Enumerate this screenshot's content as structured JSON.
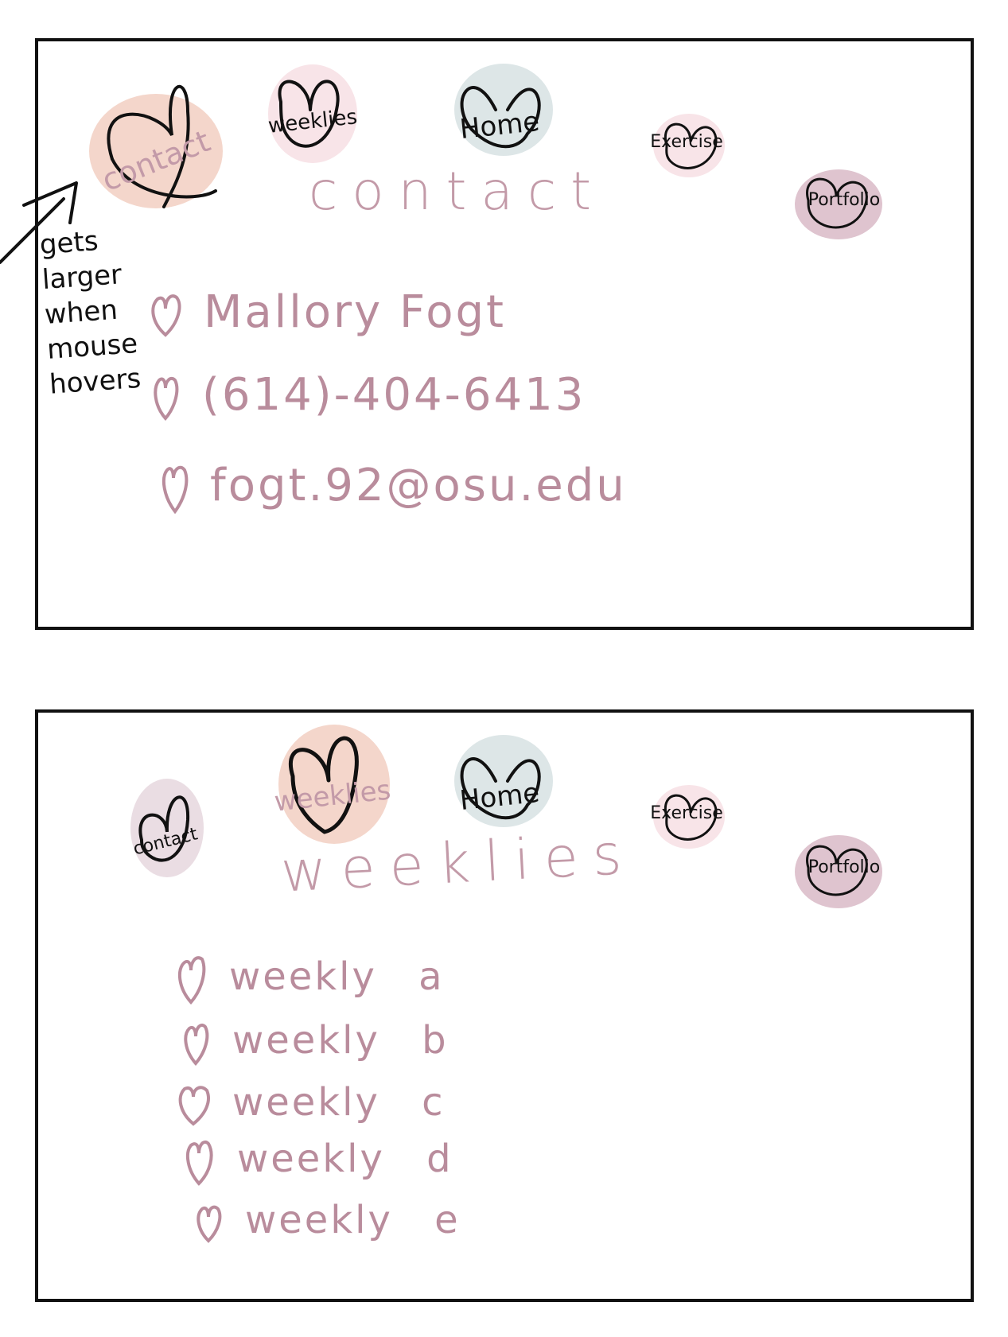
{
  "nav": {
    "contact": "contact",
    "weeklies": "weeklies",
    "home": "Home",
    "exercise": "Exercise",
    "portfolio": "Portfolio"
  },
  "colors": {
    "peach": "#f4d6cb",
    "pink": "#f8e4e8",
    "blue_gray": "#dde6e7",
    "mauve": "#dfc4cf",
    "ink": "#111111",
    "text_mauve": "#b98c9c"
  },
  "contact_page": {
    "title": "contact",
    "annotation": "gets\nlarger\nwhen\nmouse\nhovers",
    "lines": [
      "Mallory Fogt",
      "(614)-404-6413",
      "fogt.92@osu.edu"
    ]
  },
  "weeklies_page": {
    "title": "weeklies",
    "items": [
      {
        "label": "weekly",
        "letter": "a"
      },
      {
        "label": "weekly",
        "letter": "b"
      },
      {
        "label": "weekly",
        "letter": "c"
      },
      {
        "label": "weekly",
        "letter": "d"
      },
      {
        "label": "weekly",
        "letter": "e"
      }
    ]
  },
  "icons": [
    "heart-icon",
    "arrow-icon"
  ]
}
